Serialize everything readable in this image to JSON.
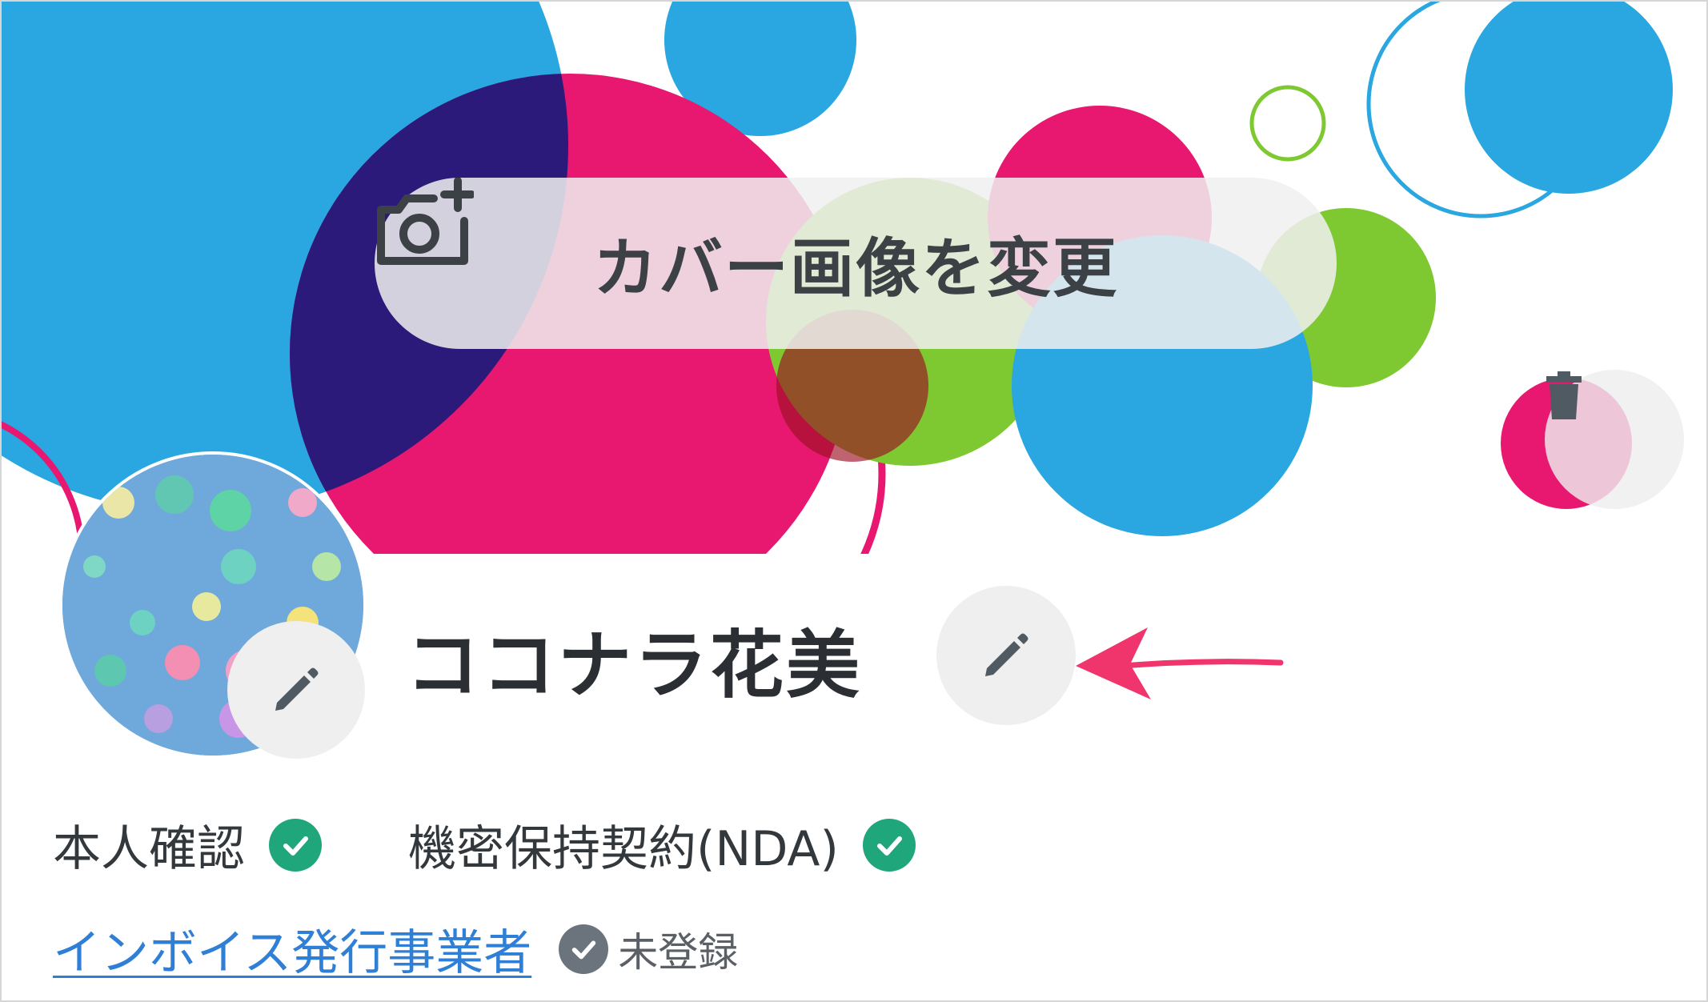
{
  "cover": {
    "change_button_label": "カバー画像を変更",
    "camera_icon": "add-photo-camera-icon",
    "delete_icon": "trash-icon"
  },
  "profile": {
    "name": "ココナラ花美",
    "avatar_edit_icon": "pencil-icon",
    "name_edit_icon": "pencil-icon"
  },
  "verifications": {
    "identity_label": "本人確認",
    "nda_label": "機密保持契約(NDA)",
    "check_icon": "check-circle-icon"
  },
  "invoice": {
    "link_label": "インボイス発行事業者",
    "status": "未登録"
  },
  "colors": {
    "blue": "#2aa6e0",
    "pink": "#e8176f",
    "navy": "#2b1a7a",
    "green": "#7ec832",
    "check_green": "#1fa67a",
    "link_blue": "#2f7fd6",
    "annotation_arrow": "#f0356c"
  }
}
